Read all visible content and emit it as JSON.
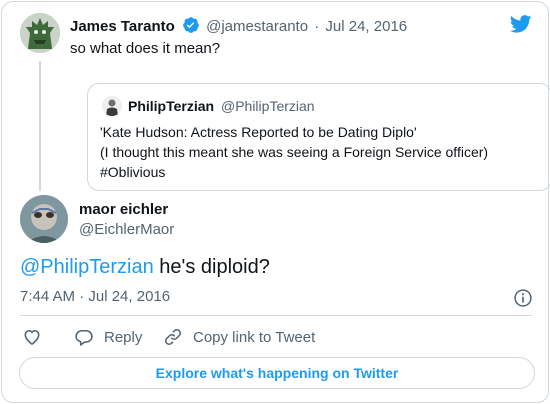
{
  "parent_tweet": {
    "author_name": "James Taranto",
    "author_handle": "@jamestaranto",
    "separator": "·",
    "date": "Jul 24, 2016",
    "text": "so what does it mean?",
    "quoted_tweet": {
      "author_name": "PhilipTerzian",
      "author_handle": "@PhilipTerzian",
      "lines": [
        "'Kate Hudson: Actress Reported to be Dating Diplo'",
        "(I thought this meant she was seeing a Foreign Service officer)",
        "#Oblivious"
      ]
    }
  },
  "main_tweet": {
    "author_name": "maor eichler",
    "author_handle": "@EichlerMaor",
    "mention": "@PhilipTerzian",
    "text": " he's diploid?",
    "timestamp": "7:44 AM · Jul 24, 2016"
  },
  "actions": {
    "like_icon": "heart-icon",
    "reply_label": "Reply",
    "copy_link_label": "Copy link to Tweet"
  },
  "explore_label": "Explore what's happening on Twitter",
  "colors": {
    "accent": "#1d9bf0",
    "text": "#0f1419",
    "muted": "#536471",
    "border": "#cfd9de"
  }
}
